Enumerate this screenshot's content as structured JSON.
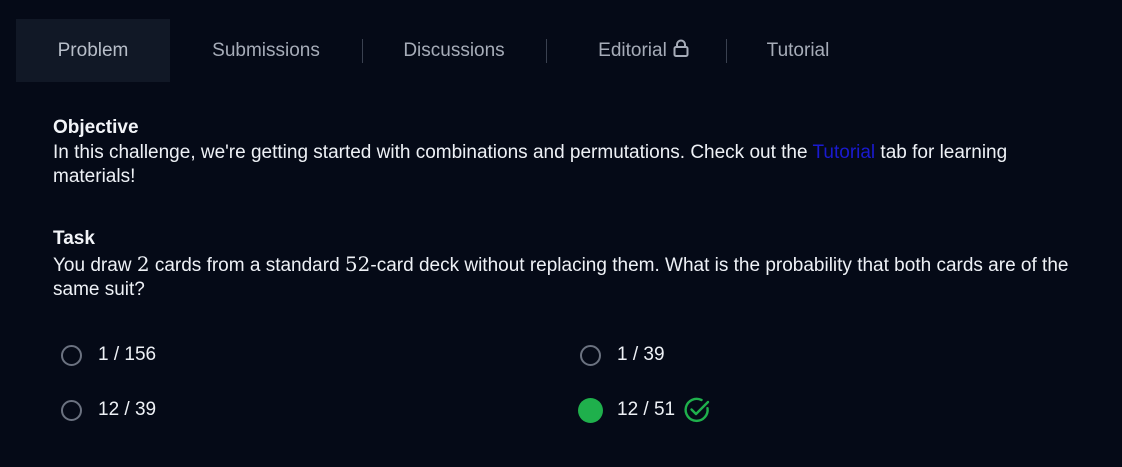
{
  "tabs": [
    {
      "label": "Problem",
      "active": true
    },
    {
      "label": "Submissions",
      "active": false
    },
    {
      "label": "Discussions",
      "active": false
    },
    {
      "label": "Editorial",
      "active": false,
      "icon": "lock-icon"
    },
    {
      "label": "Tutorial",
      "active": false
    }
  ],
  "objective": {
    "heading": "Objective",
    "text_before": "In this challenge, we're getting started with combinations and permutations. Check out the ",
    "link": "Tutorial",
    "text_after": " tab for learning materials!"
  },
  "task": {
    "heading": "Task",
    "text_1": "You draw ",
    "num_1": "2",
    "text_2": " cards from a standard ",
    "num_2": "52",
    "text_3": "-card deck without replacing them. What is the probability that both cards are of the same suit?"
  },
  "options": [
    {
      "label": "1 / 156",
      "selected": false
    },
    {
      "label": "1 / 39",
      "selected": false
    },
    {
      "label": "12 / 39",
      "selected": false
    },
    {
      "label": "12 / 51",
      "selected": true,
      "correct_icon": "check-circle-icon"
    }
  ],
  "colors": {
    "background": "#050a17",
    "active_tab": "#111826",
    "link": "#1a1ad0",
    "selected": "#1fb04c"
  }
}
